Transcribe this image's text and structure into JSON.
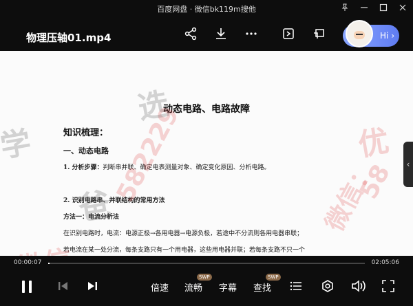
{
  "window": {
    "app_title": "百度网盘 · 微信bk119m搜他",
    "video_title": "物理压轴01.mp4"
  },
  "assistant": {
    "label": "Hi"
  },
  "document": {
    "heading": "动态电路、电路故障",
    "subheading": "知识梳理：",
    "section1": "一、动态电路",
    "line1_bold": "1. 分析步骤：",
    "line1_text": "判断串并联、确定电表测量对象、确定变化原因、分析电路。",
    "line2": "2. 识别电路串、并联结构的常用方法",
    "line3": "方法一：电流分析法",
    "line4": "在识别电路时，电流：电源正极→各用电器→电源负极，若途中不分流则各用电器串联；",
    "line5": "若电流在某一处分流，每条支路只有一个用电器，这些用电器并联；若每条支路不只一个"
  },
  "watermark": {
    "t1": "学",
    "t2": "爸",
    "t3": "微信",
    "t4": "582229",
    "t5": "选",
    "t6": "优",
    "t7": "微信：",
    "t8": "58"
  },
  "player": {
    "current_time": "00:00:07",
    "total_time": "02:05:06",
    "progress": 0.001,
    "speed_label": "倍速",
    "quality_label": "流畅",
    "subtitle_label": "字幕",
    "search_label": "查找",
    "swp_badge": "SWP",
    "swp_badge2": "SWP"
  },
  "icons": {
    "share": "share-icon",
    "download": "download-icon",
    "more": "more-icon",
    "screenshot": "screen-capture-icon",
    "pip": "pip-icon",
    "pause": "pause-icon",
    "prev": "previous-icon",
    "next": "next-icon",
    "list": "playlist-icon",
    "settings": "settings-icon",
    "volume": "volume-icon",
    "fullscreen": "fullscreen-icon"
  }
}
